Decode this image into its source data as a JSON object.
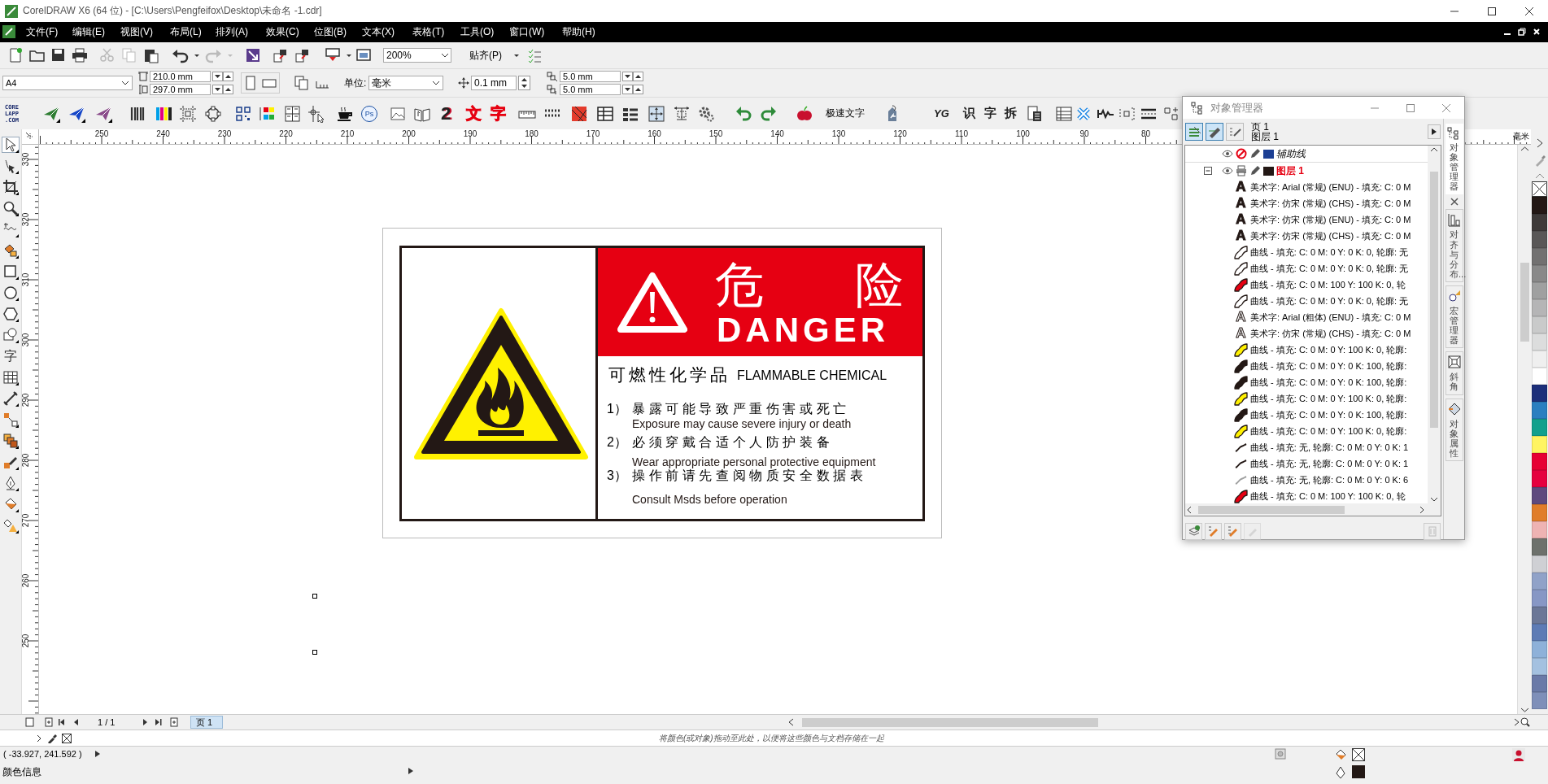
{
  "window": {
    "title": "CorelDRAW X6 (64 位) - [C:\\Users\\Pengfeifox\\Desktop\\未命名 -1.cdr]"
  },
  "menu": [
    "文件(F)",
    "编辑(E)",
    "视图(V)",
    "布局(L)",
    "排列(A)",
    "效果(C)",
    "位图(B)",
    "文本(X)",
    "表格(T)",
    "工具(O)",
    "窗口(W)",
    "帮助(H)"
  ],
  "standard_toolbar": {
    "buttons": [
      {
        "disabled": false
      },
      {
        "disabled": false
      },
      {
        "disabled": false
      },
      {
        "disabled": false
      },
      {
        "disabled": true
      },
      {
        "disabled": true
      },
      {
        "disabled": false
      },
      {
        "disabled": false
      },
      {
        "disabled": false
      },
      {
        "disabled": true
      },
      {
        "disabled": true
      },
      {
        "disabled": false
      },
      {
        "disabled": false
      },
      {
        "disabled": false
      },
      {
        "disabled": false
      },
      {
        "disabled": false
      },
      {
        "disabled": false
      }
    ],
    "zoom": "200%",
    "snap": "贴齐(P)"
  },
  "property_bar": {
    "page_size": "A4",
    "width": "210.0 mm",
    "height": "297.0 mm",
    "units_label": "单位:",
    "units": "毫米",
    "nudge": "0.1 mm",
    "duplicate_x": "5.0 mm",
    "duplicate_y": "5.0 mm"
  },
  "plugin_toolbar": {
    "logo": [
      "CORE",
      "LAPP",
      ".COM"
    ],
    "glyphs": [
      "Ps",
      "2",
      "文",
      "字",
      "YG",
      "识",
      "字",
      "拆"
    ],
    "text_button": "极速文字"
  },
  "toolbox": {
    "text_tool": "字",
    "tools": [
      {
        "selected": true
      },
      {
        "selected": false
      },
      {
        "selected": false
      },
      {
        "selected": false
      },
      {
        "selected": false
      },
      {
        "selected": false
      },
      {
        "selected": false
      },
      {
        "selected": false
      },
      {
        "selected": false
      },
      {
        "selected": false
      },
      {
        "selected": false
      },
      {
        "selected": false
      },
      {
        "selected": false
      },
      {
        "selected": false
      },
      {
        "selected": false
      },
      {
        "selected": false
      },
      {
        "selected": false
      },
      {
        "selected": false
      },
      {
        "selected": false
      }
    ]
  },
  "rulers": {
    "horizontal": [
      "250",
      "240",
      "230",
      "220",
      "210",
      "200",
      "190",
      "180",
      "170",
      "160",
      "150",
      "140",
      "130",
      "120",
      "110",
      "100",
      "90",
      "80"
    ],
    "vertical": [
      "330",
      "320",
      "310",
      "300",
      "290",
      "280",
      "270",
      "260",
      "250"
    ],
    "unit": "毫米"
  },
  "canvas": {
    "sign": {
      "heading_left": "危",
      "heading_right": "险",
      "heading_en": "DANGER",
      "title_cn": "可燃性化学品",
      "title_en": "FLAMMABLE CHEMICAL",
      "items": [
        {
          "number": "1）",
          "cn": "暴露可能导致严重伤害或死亡",
          "en": "Exposure may cause severe injury or death"
        },
        {
          "number": "2）",
          "cn": "必须穿戴合适个人防护装备",
          "en": "Wear appropriate personal protective equipment"
        },
        {
          "number": "3）",
          "cn": "操作前请先查阅物质安全数据表",
          "en": "Consult Msds before operation"
        }
      ]
    }
  },
  "object_manager": {
    "title": "对象管理器",
    "page": "页 1",
    "layer": "图层 1",
    "toggles": [
      {
        "on": true
      },
      {
        "on": true
      },
      {
        "on": false
      }
    ],
    "layers": [
      {
        "name": "辅助线",
        "kind": "guides",
        "color": "#1c3f94",
        "selected": false,
        "printable": false
      },
      {
        "name": "图层 1",
        "kind": "layer",
        "color": "#231815",
        "selected": true,
        "printable": true,
        "expanded": true,
        "children": [
          {
            "kind": "text",
            "glyph": "A",
            "color": "#231815",
            "label": "美术字: Arial (常规) (ENU) - 填充: C: 0 M"
          },
          {
            "kind": "text",
            "glyph": "A",
            "color": "#231815",
            "label": "美术字: 仿宋 (常规) (CHS) - 填充: C: 0 M"
          },
          {
            "kind": "text",
            "glyph": "A",
            "color": "#231815",
            "label": "美术字: 仿宋 (常规) (ENU) - 填充: C: 0 M"
          },
          {
            "kind": "text",
            "glyph": "A",
            "color": "#231815",
            "label": "美术字: 仿宋 (常规) (CHS) - 填充: C: 0 M"
          },
          {
            "kind": "curve",
            "color": "#ffffff",
            "label": "曲线 - 填充: C: 0 M: 0 Y: 0 K: 0, 轮廓: 无"
          },
          {
            "kind": "curve",
            "color": "#ffffff",
            "label": "曲线 - 填充: C: 0 M: 0 Y: 0 K: 0, 轮廓: 无"
          },
          {
            "kind": "curve",
            "color": "#e60012",
            "label": "曲线 - 填充: C: 0 M: 100 Y: 100 K: 0, 轮"
          },
          {
            "kind": "curve",
            "color": "#ffffff",
            "label": "曲线 - 填充: C: 0 M: 0 Y: 0 K: 0, 轮廓: 无"
          },
          {
            "kind": "text",
            "glyph": "A",
            "color": "#ffffff",
            "label": "美术字: Arial (粗体) (ENU) - 填充: C: 0 M"
          },
          {
            "kind": "text",
            "glyph": "A",
            "color": "#ffffff",
            "label": "美术字: 仿宋 (常规) (CHS) - 填充: C: 0 M"
          },
          {
            "kind": "curve",
            "color": "#fff100",
            "label": "曲线 - 填充: C: 0 M: 0 Y: 100 K: 0, 轮廓:"
          },
          {
            "kind": "curve",
            "color": "#231815",
            "label": "曲线 - 填充: C: 0 M: 0 Y: 0 K: 100, 轮廓:"
          },
          {
            "kind": "curve",
            "color": "#231815",
            "label": "曲线 - 填充: C: 0 M: 0 Y: 0 K: 100, 轮廓:"
          },
          {
            "kind": "curve",
            "color": "#fff100",
            "label": "曲线 - 填充: C: 0 M: 0 Y: 100 K: 0, 轮廓:"
          },
          {
            "kind": "curve",
            "color": "#231815",
            "label": "曲线 - 填充: C: 0 M: 0 Y: 0 K: 100, 轮廓:"
          },
          {
            "kind": "curve",
            "color": "#fff100",
            "label": "曲线 - 填充: C: 0 M: 0 Y: 100 K: 0, 轮廓:"
          },
          {
            "kind": "line",
            "color": "#231815",
            "label": "曲线 - 填充: 无, 轮廓: C: 0 M: 0 Y: 0 K: 1"
          },
          {
            "kind": "line",
            "color": "#231815",
            "label": "曲线 - 填充: 无, 轮廓: C: 0 M: 0 Y: 0 K: 1"
          },
          {
            "kind": "line",
            "color": "#9fa0a0",
            "label": "曲线 - 填充: 无, 轮廓: C: 0 M: 0 Y: 0 K: 6"
          },
          {
            "kind": "curve",
            "color": "#e60012",
            "label": "曲线 - 填充: C: 0 M: 100 Y: 100 K: 0, 轮"
          }
        ]
      }
    ]
  },
  "docker_tabs": [
    {
      "label": "对象管理器",
      "selected": true
    },
    {
      "label": "对齐与分布...",
      "selected": false
    },
    {
      "label": "宏管理器",
      "selected": false
    },
    {
      "label": "斜角",
      "selected": false
    },
    {
      "label": "对象属性",
      "selected": false
    }
  ],
  "page_navigator": {
    "count": "1 / 1",
    "tabs": [
      {
        "label": "页 1",
        "selected": true
      }
    ]
  },
  "palette_hint": "将颜色(或对象)拖动至此处，以便将这些颜色与文档存储在一起",
  "palette": [
    {
      "color": "#231815"
    },
    {
      "color": "#3e3a39"
    },
    {
      "color": "#595757"
    },
    {
      "color": "#727171"
    },
    {
      "color": "#898989"
    },
    {
      "color": "#9fa0a0"
    },
    {
      "color": "#b5b5b6"
    },
    {
      "color": "#c9caca"
    },
    {
      "color": "#dcdddd"
    },
    {
      "color": "#efefef"
    },
    {
      "color": "#ffffff"
    },
    {
      "color": "#1d2f7a"
    },
    {
      "color": "#2a7fc0"
    },
    {
      "color": "#12a08c"
    },
    {
      "color": "#fff462"
    },
    {
      "color": "#e60033"
    },
    {
      "color": "#e5003f"
    },
    {
      "color": "#5e4a7e"
    },
    {
      "color": "#e07d2a"
    },
    {
      "color": "#eeb3b3"
    },
    {
      "color": "#6d716c"
    },
    {
      "color": "#cfd0d4"
    },
    {
      "color": "#90a2c8"
    },
    {
      "color": "#8797c5"
    },
    {
      "color": "#6b7797"
    },
    {
      "color": "#5d7bb5"
    },
    {
      "color": "#8eb1d9"
    },
    {
      "color": "#a4c1e0"
    },
    {
      "color": "#6a7aa8"
    },
    {
      "color": "#7e8fb9"
    }
  ],
  "status_bar": {
    "coordinates": "( -33.927, 241.592 )",
    "color_info": "颜色信息"
  }
}
